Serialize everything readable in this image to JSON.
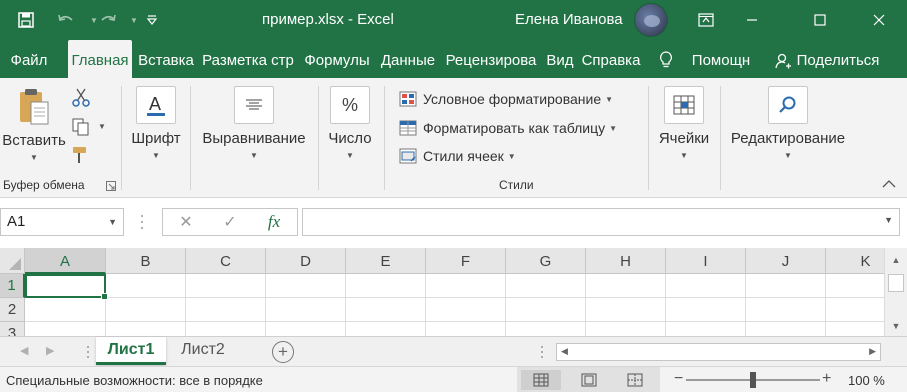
{
  "app": {
    "title": "пример.xlsx  -  Excel",
    "user": "Елена Иванова"
  },
  "colors": {
    "brand": "#217346",
    "ribbon": "#f3f3f3",
    "grid_line": "#dcdcdc"
  },
  "tabs": [
    {
      "label": "Файл",
      "active": false
    },
    {
      "label": "Главная",
      "active": true
    },
    {
      "label": "Вставка",
      "active": false
    },
    {
      "label": "Разметка стр",
      "active": false
    },
    {
      "label": "Формулы",
      "active": false
    },
    {
      "label": "Данные",
      "active": false
    },
    {
      "label": "Рецензирова",
      "active": false
    },
    {
      "label": "Вид",
      "active": false
    },
    {
      "label": "Справка",
      "active": false
    }
  ],
  "tell_me": {
    "label": "Помощн",
    "icon": "lightbulb-icon"
  },
  "share": {
    "label": "Поделиться",
    "icon": "person-icon"
  },
  "ribbon": {
    "clipboard": {
      "paste": "Вставить",
      "group": "Буфер обмена"
    },
    "font": {
      "label": "Шрифт"
    },
    "alignment": {
      "label": "Выравнивание"
    },
    "number": {
      "label": "Число",
      "icon_text": "%"
    },
    "styles": {
      "conditional": "Условное форматирование",
      "as_table": "Форматировать как таблицу",
      "cell_styles": "Стили ячеек",
      "group": "Стили"
    },
    "cells": {
      "label": "Ячейки"
    },
    "editing": {
      "label": "Редактирование"
    }
  },
  "formula_bar": {
    "name_box": "A1",
    "cancel_glyph": "✕",
    "enter_glyph": "✓",
    "fx_glyph": "fx",
    "value": ""
  },
  "grid": {
    "columns": [
      "A",
      "B",
      "C",
      "D",
      "E",
      "F",
      "G",
      "H",
      "I",
      "J",
      "K"
    ],
    "rows": [
      "1",
      "2",
      "3"
    ],
    "active_cell": "A1"
  },
  "sheets": [
    {
      "label": "Лист1",
      "active": true
    },
    {
      "label": "Лист2",
      "active": false
    }
  ],
  "status": {
    "accessibility": "Специальные возможности: все в порядке",
    "zoom": "100 %"
  }
}
